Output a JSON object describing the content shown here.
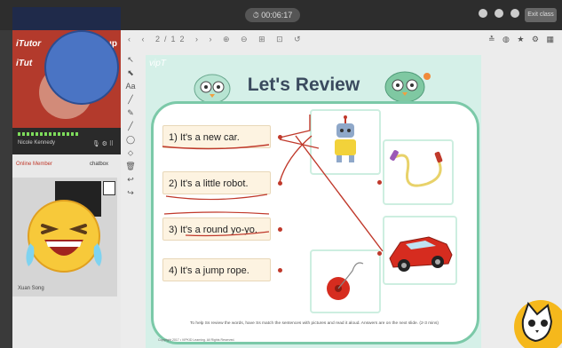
{
  "topbar": {
    "timer": "⏱ 00:06:17",
    "exit_label": "Exit class"
  },
  "left_panel": {
    "brand_top_left": "iTutor",
    "brand_top_right": "oup",
    "brand_mid_left": "iTut",
    "brand_mid_right": "oup",
    "teacher_name": "Nicole Kennedy",
    "teacher_icons": "🎙 ⚙ ⠿",
    "members_label": "Online Member",
    "members_right": "chatbox",
    "student_name": "Xuan Song"
  },
  "toolbar": {
    "left_icons": "‹ ‹ 2/12 › › ⊕ ⊖ ⊞ ⊡ ↺",
    "page": "2/12",
    "right_icons": "≛ ◍ ★ ⚙ ▦"
  },
  "tools": [
    "↖",
    "⬉",
    "Aa",
    "╱",
    "✎",
    "╱",
    "◯",
    "⬦",
    "🗑",
    "↩",
    "↪"
  ],
  "slide": {
    "logo": "vipT",
    "title": "Let's Review",
    "sentences": [
      "1) It's a new car.",
      "2) It's a little robot.",
      "3) It's a round yo-yo.",
      "4) It's a jump rope."
    ],
    "footnote": "To help Ss review the words, have Ss match the sentences with pictures and read it aloud. Answers are on the next slide. (2-3 mins)",
    "copyright": "Copyright 2017 • VIPKID Learning. All Rights Reserved."
  },
  "colors": {
    "accent_red": "#c0392b",
    "board_border": "#7bc9a8",
    "slide_bg": "#d5f0e8"
  }
}
